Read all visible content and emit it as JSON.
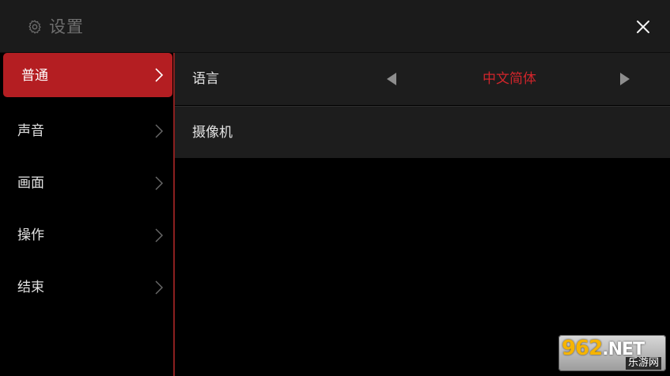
{
  "header": {
    "title": "设置",
    "gear_icon": "gear-icon",
    "close_icon": "close-icon"
  },
  "sidebar": {
    "items": [
      {
        "label": "普通",
        "active": true
      },
      {
        "label": "声音",
        "active": false
      },
      {
        "label": "画面",
        "active": false
      },
      {
        "label": "操作",
        "active": false
      },
      {
        "label": "结束",
        "active": false
      }
    ]
  },
  "content": {
    "rows": [
      {
        "label": "语言",
        "value": "中文简体"
      },
      {
        "label": "摄像机"
      }
    ]
  },
  "watermark": {
    "num": "962",
    "net": ".NET",
    "sub": "乐游网"
  },
  "colors": {
    "accent": "#b41e22",
    "value_red": "#d0252b",
    "header_bg": "#1b1b1b",
    "row_bg": "#1d1d1d"
  }
}
